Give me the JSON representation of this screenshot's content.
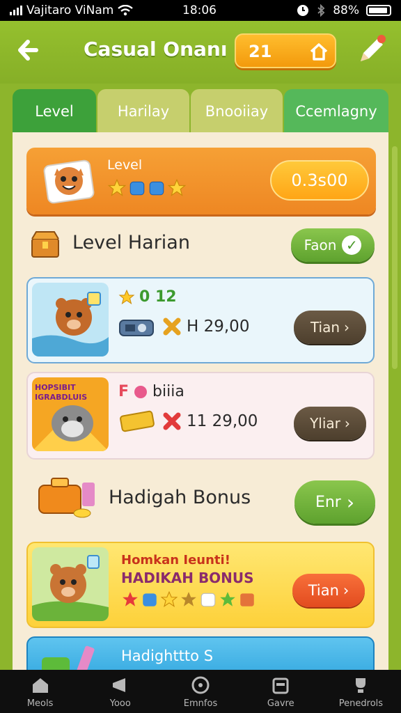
{
  "status": {
    "carrier": "Vajitaro ViNam",
    "time": "18:06",
    "battery": "88%"
  },
  "header": {
    "title": "Casual Onanı",
    "coins": "21"
  },
  "tabs": [
    "Level",
    "Harilay",
    "Bnooiiay",
    "Ccemlagny"
  ],
  "level_card": {
    "label": "Level",
    "timer": "0.3s00"
  },
  "daily": {
    "title": "Level Harian",
    "button": "Faon"
  },
  "tasks": [
    {
      "line1": "0  12",
      "line2": "H 29,00",
      "button": "Tian"
    },
    {
      "picture_caption": "HOPSIBIT IGRABDLUIS",
      "line1": "biiia",
      "line2": "11 29,00",
      "button": "Yliar"
    }
  ],
  "bonus": {
    "title": "Hadigah Bonus",
    "button": "Enr"
  },
  "bonus_card": {
    "line1": "Homkan Ieunti!",
    "line2": "HADIKAH BONUS",
    "button": "Tian"
  },
  "peek_card": {
    "text": "Hadighttto S"
  },
  "nav": [
    "Meols",
    "Yooo",
    "Emnfos",
    "Gavre",
    "Penedrols"
  ],
  "colors": {
    "bg": "#8db52c",
    "orange": "#f39a0c",
    "brown": "#4d3f2d",
    "green": "#5ea22e"
  }
}
